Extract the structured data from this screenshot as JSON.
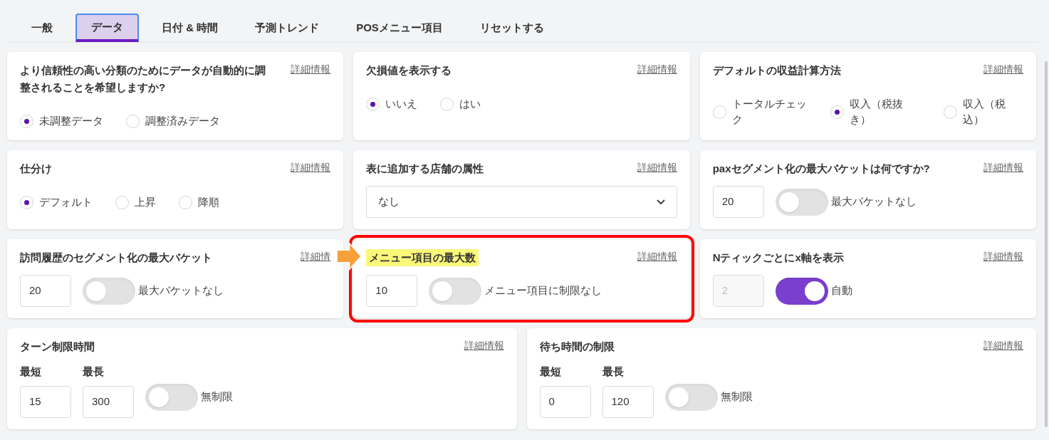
{
  "tabs": [
    {
      "label": "一般",
      "selected": false
    },
    {
      "label": "データ",
      "selected": true
    },
    {
      "label": "日付 & 時間",
      "selected": false
    },
    {
      "label": "予測トレンド",
      "selected": false
    },
    {
      "label": "POSメニュー項目",
      "selected": false
    },
    {
      "label": "リセットする",
      "selected": false
    }
  ],
  "rows": [
    [
      {
        "kind": "radio",
        "title": "より信頼性の高い分類のためにデータが自動的に調整されることを希望しますか?",
        "info_link": "詳細情報",
        "options": [
          {
            "label": "未調整データ",
            "selected": true
          },
          {
            "label": "調整済みデータ",
            "selected": false
          }
        ]
      },
      {
        "kind": "radio",
        "title": "欠損値を表示する",
        "info_link": "詳細情報",
        "options": [
          {
            "label": "いいえ",
            "selected": true
          },
          {
            "label": "はい",
            "selected": false
          }
        ]
      },
      {
        "kind": "radio",
        "title": "デフォルトの収益計算方法",
        "info_link": "詳細情報",
        "options": [
          {
            "label": "トータルチェック",
            "selected": false
          },
          {
            "label": "収入（税抜き）",
            "selected": true
          },
          {
            "label": "収入（税込）",
            "selected": false
          }
        ]
      }
    ],
    [
      {
        "kind": "radio",
        "title": "仕分け",
        "info_link": "詳細情報",
        "options": [
          {
            "label": "デフォルト",
            "selected": true
          },
          {
            "label": "上昇",
            "selected": false
          },
          {
            "label": "降順",
            "selected": false
          }
        ]
      },
      {
        "kind": "select",
        "title": "表に追加する店舗の属性",
        "info_link": "詳細情報",
        "value": "なし"
      },
      {
        "kind": "number_toggle",
        "title": "paxセグメント化の最大バケットは何ですか?",
        "info_link": "詳細情報",
        "number": {
          "value": "20",
          "disabled": false
        },
        "toggle": {
          "on": false,
          "label": "最大バケットなし"
        }
      }
    ],
    [
      {
        "kind": "number_toggle",
        "title": "訪問履歴のセグメント化の最大バケット",
        "info_link": "詳細情",
        "number": {
          "value": "20",
          "disabled": false
        },
        "toggle": {
          "on": false,
          "label": "最大バケットなし"
        }
      },
      {
        "kind": "number_toggle",
        "title": "メニュー項目の最大数",
        "info_link": "詳細情報",
        "highlighted": true,
        "number": {
          "value": "10",
          "disabled": false
        },
        "toggle": {
          "on": false,
          "label": "メニュー項目に制限なし"
        }
      },
      {
        "kind": "number_toggle",
        "title": "Nティックごとにx軸を表示",
        "info_link": "詳細情報",
        "number": {
          "value": "2",
          "disabled": true
        },
        "toggle": {
          "on": true,
          "label": "自動"
        }
      }
    ],
    [
      {
        "kind": "range",
        "title": "ターン制限時間",
        "info_link": "詳細情報",
        "fields": [
          {
            "label": "最短",
            "value": "15"
          },
          {
            "label": "最長",
            "value": "300"
          }
        ],
        "toggle": {
          "on": false,
          "label": "無制限"
        }
      },
      {
        "kind": "range",
        "title": "待ち時間の制限",
        "info_link": "詳細情報",
        "fields": [
          {
            "label": "最短",
            "value": "0"
          },
          {
            "label": "最長",
            "value": "120"
          }
        ],
        "toggle": {
          "on": false,
          "label": "無制限"
        }
      }
    ]
  ]
}
